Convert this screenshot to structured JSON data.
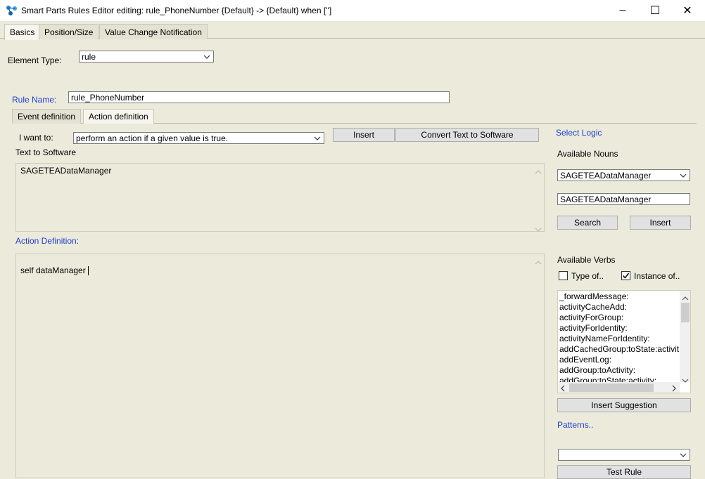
{
  "window": {
    "title": "Smart Parts Rules Editor editing: rule_PhoneNumber {Default} -> {Default} when ['']",
    "minimize_glyph": "–",
    "maximize_glyph": "☐",
    "close_glyph": "✕"
  },
  "top_tabs": [
    "Basics",
    "Position/Size",
    "Value Change Notification"
  ],
  "element_type": {
    "label": "Element Type:",
    "value": "rule"
  },
  "rule_name": {
    "label": "Rule Name:",
    "value": "rule_PhoneNumber"
  },
  "sub_tabs": [
    "Event definition",
    "Action definition"
  ],
  "i_want_to": {
    "label": "I want to:",
    "value": "perform an action if a given value is true."
  },
  "buttons": {
    "insert": "Insert",
    "convert": "Convert Text to Software",
    "search": "Search",
    "insert_noun": "Insert",
    "insert_suggestion": "Insert Suggestion",
    "test_rule": "Test Rule"
  },
  "text_to_software": {
    "label": "Text to Software",
    "content": "SAGETEADataManager"
  },
  "action_definition": {
    "label": "Action Definition:",
    "content": "self dataManager"
  },
  "right_panel": {
    "select_logic": "Select Logic",
    "available_nouns": "Available Nouns",
    "noun_combo_value": "SAGETEADataManager",
    "noun_field_value": "SAGETEADataManager",
    "available_verbs": "Available Verbs",
    "type_of": "Type of..",
    "instance_of": "Instance of..",
    "type_of_checked": false,
    "instance_of_checked": true,
    "verbs": [
      "_forwardMessage:",
      "activityCacheAdd:",
      "activityForGroup:",
      "activityForIdentity:",
      "activityNameForIdentity:",
      "addCachedGroup:toState:activity:",
      "addEventLog:",
      "addGroup:toActivity:",
      "addGroup:toState:activity:"
    ],
    "patterns": "Patterns..",
    "patterns_value": ""
  },
  "colors": {
    "window_bg": "#ebeadb",
    "link_blue": "#1f3fd1"
  }
}
